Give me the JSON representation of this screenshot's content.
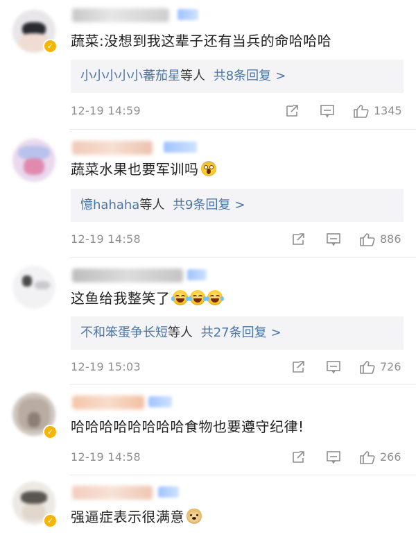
{
  "comments": [
    {
      "text": "蔬菜:没想到我这辈子还有当兵的命哈哈哈",
      "emoji": [],
      "reply_users": "小小小小小蕃茄星",
      "reply_suffix": "等人",
      "reply_count": "共8条回复",
      "reply_arrow": ">",
      "time": "12-19 14:59",
      "likes": "1345",
      "verified": true
    },
    {
      "text": "蔬菜水果也要军训吗",
      "emoji": [
        "scream-emoji"
      ],
      "reply_users": "憶hahaha",
      "reply_suffix": "等人",
      "reply_count": "共9条回复",
      "reply_arrow": ">",
      "time": "12-19 14:58",
      "likes": "886",
      "verified": false
    },
    {
      "text": "这鱼给我整笑了",
      "emoji": [
        "laugh-cry-emoji",
        "laugh-cry-emoji",
        "laugh-cry-emoji"
      ],
      "reply_users": "不和笨蛋争长短",
      "reply_suffix": "等人",
      "reply_count": "共27条回复",
      "reply_arrow": ">",
      "time": "12-19 15:03",
      "likes": "726",
      "verified": false
    },
    {
      "text": "哈哈哈哈哈哈哈哈食物也要遵守纪律!",
      "emoji": [],
      "reply_users": "",
      "reply_suffix": "",
      "reply_count": "",
      "reply_arrow": "",
      "time": "12-19 14:58",
      "likes": "266",
      "verified": true
    },
    {
      "text": "强逼症表示很满意",
      "emoji": [
        "doge-emoji"
      ],
      "reply_users": "",
      "reply_suffix": "",
      "reply_count": "",
      "reply_arrow": "",
      "time": "",
      "likes": "",
      "verified": true
    }
  ],
  "colors": {
    "link_blue": "#4a75a9",
    "meta_gray": "#8e8e8e",
    "reply_bg": "#f4f4f6",
    "verified_badge": "#f7b500"
  },
  "icons": [
    "share-icon",
    "comment-icon",
    "like-icon"
  ]
}
